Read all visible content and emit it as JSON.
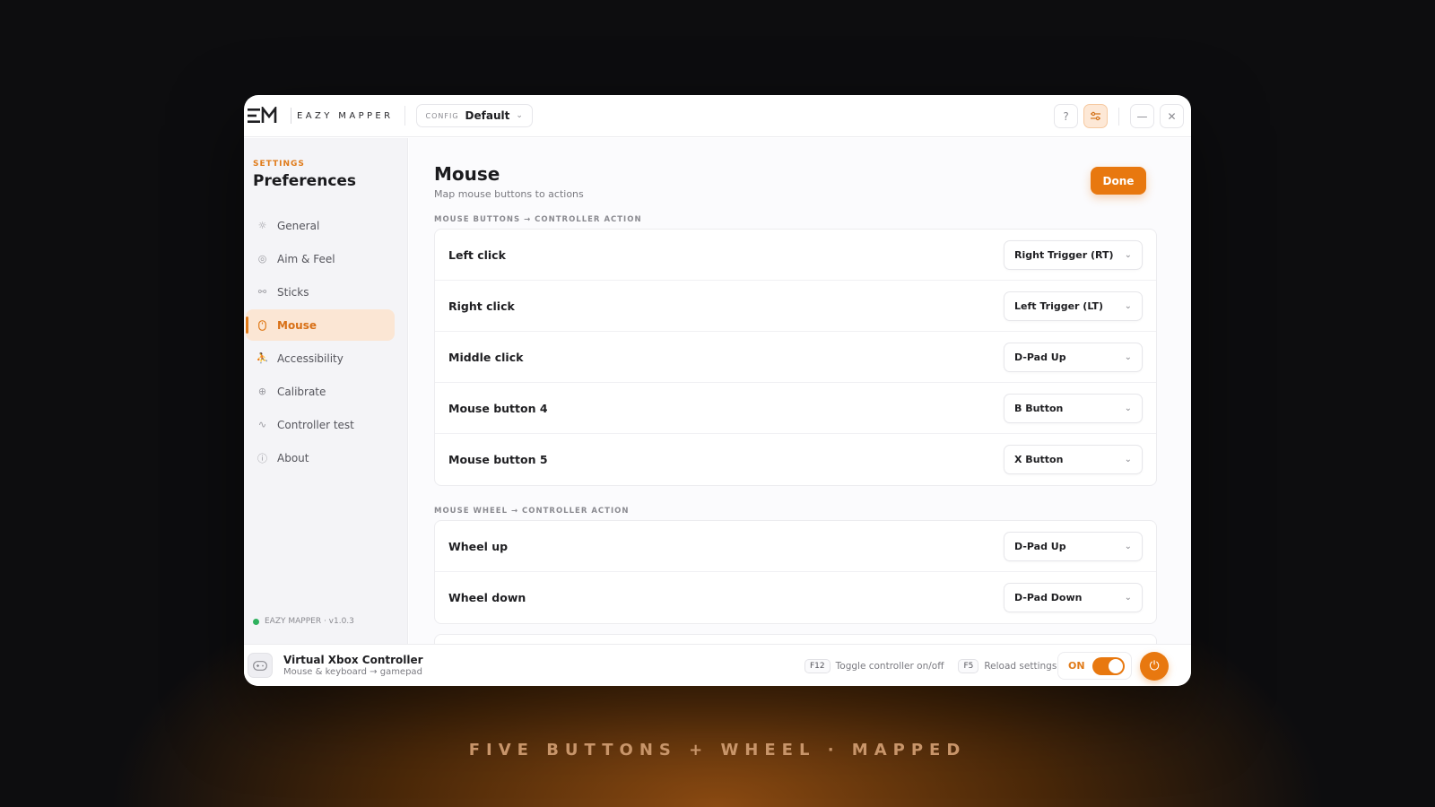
{
  "app": {
    "logo_text": "EAZY MAPPER",
    "config_label": "CONFIG",
    "config_value": "Default"
  },
  "sidebar": {
    "eyebrow": "SETTINGS",
    "title": "Preferences",
    "items": [
      {
        "label": "General",
        "icon": "sun-icon"
      },
      {
        "label": "Aim & Feel",
        "icon": "target-icon"
      },
      {
        "label": "Sticks",
        "icon": "sticks-icon"
      },
      {
        "label": "Mouse",
        "icon": "mouse-icon",
        "active": true
      },
      {
        "label": "Accessibility",
        "icon": "accessibility-icon"
      },
      {
        "label": "Calibrate",
        "icon": "crosshair-icon"
      },
      {
        "label": "Controller test",
        "icon": "pulse-icon"
      },
      {
        "label": "About",
        "icon": "info-icon"
      }
    ],
    "version": "EAZY MAPPER · v1.0.3"
  },
  "main": {
    "title": "Mouse",
    "subtitle": "Map mouse buttons to actions",
    "done_label": "Done",
    "buttons_section": "MOUSE BUTTONS → CONTROLLER ACTION",
    "buttons": [
      {
        "label": "Left click",
        "value": "Right Trigger (RT)"
      },
      {
        "label": "Right click",
        "value": "Left Trigger (LT)"
      },
      {
        "label": "Middle click",
        "value": "D-Pad Up"
      },
      {
        "label": "Mouse button 4",
        "value": "B Button"
      },
      {
        "label": "Mouse button 5",
        "value": "X Button"
      }
    ],
    "wheel_section": "MOUSE WHEEL → CONTROLLER ACTION",
    "wheel": [
      {
        "label": "Wheel up",
        "value": "D-Pad Up"
      },
      {
        "label": "Wheel down",
        "value": "D-Pad Down"
      }
    ]
  },
  "footer": {
    "device_name": "Virtual Xbox Controller",
    "device_sub": "Mouse & keyboard → gamepad",
    "shortcut1_key": "F12",
    "shortcut1_desc": "Toggle controller on/off",
    "shortcut2_key": "F5",
    "shortcut2_desc": "Reload settings",
    "toggle_label": "ON",
    "toggle_on": true
  },
  "tagline": "FIVE BUTTONS + WHEEL · MAPPED",
  "colors": {
    "accent": "#e8780f",
    "status_green": "#2fb15e"
  }
}
